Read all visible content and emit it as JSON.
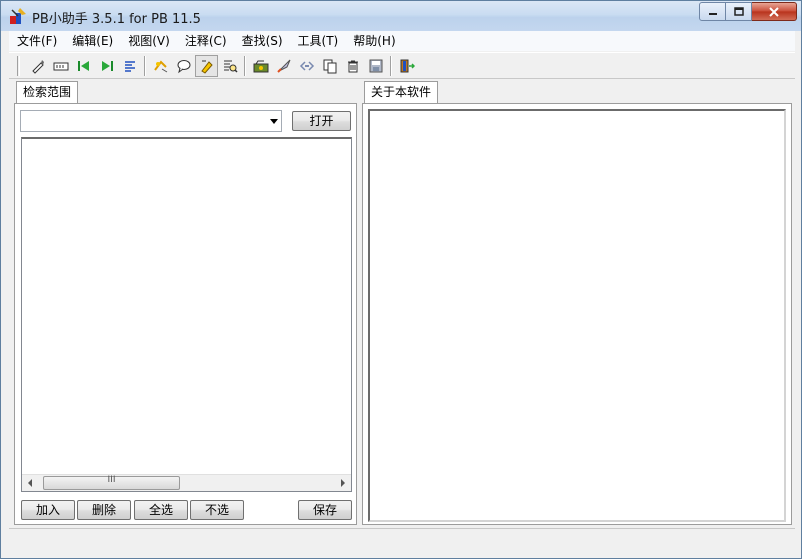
{
  "window": {
    "title": "PB小助手 3.5.1 for PB 11.5"
  },
  "menu": [
    {
      "label": "文件(F)"
    },
    {
      "label": "编辑(E)"
    },
    {
      "label": "视图(V)"
    },
    {
      "label": "注释(C)"
    },
    {
      "label": "查找(S)"
    },
    {
      "label": "工具(T)"
    },
    {
      "label": "帮助(H)"
    }
  ],
  "toolbar": {
    "icons": [
      "pen-icon",
      "rename-icon",
      "first-icon",
      "last-icon",
      "align-icon",
      "comment-icon",
      "speech-icon",
      "highlight-icon",
      "search-code-icon",
      "open-folder-icon",
      "rocket-icon",
      "html-tag-icon",
      "copy-icon",
      "trash-icon",
      "save-icon",
      "exit-icon"
    ]
  },
  "left_panel": {
    "tab_label": "检索范围",
    "combo_value": "",
    "open_button": "打开",
    "scroll_thumb_label": "III",
    "buttons": {
      "add": "加入",
      "delete": "删除",
      "select_all": "全选",
      "select_none": "不选",
      "save": "保存"
    }
  },
  "right_panel": {
    "tab_label": "关于本软件"
  },
  "colors": {
    "titlebar": "#c9dcf1",
    "close_button": "#c94a36",
    "background": "#f0f0f0"
  }
}
